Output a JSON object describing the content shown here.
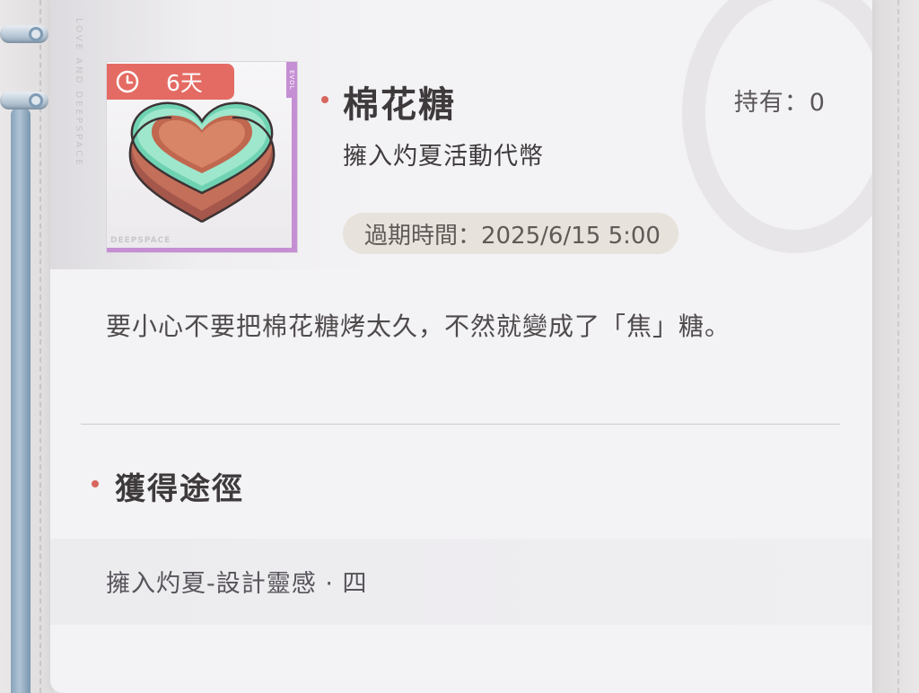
{
  "item": {
    "name": "棉花糖",
    "type": "擁入灼夏活動代幣",
    "owned": "持有：0",
    "expire": "過期時間：2025/6/15 5:00",
    "duration_badge": "6天",
    "description": "要小心不要把棉花糖烤太久，不然就變成了「焦」糖。",
    "frame_tag": "EVOL",
    "brand_tag": "DEEPSPACE"
  },
  "side_text": "LOVE AND DEEPSPACE",
  "acquire": {
    "title": "獲得途徑",
    "routes": [
      "擁入灼夏-設計靈感 · 四"
    ]
  },
  "colors": {
    "accent": "#e46b63",
    "bullet": "#d7675e",
    "frame_purple": "#c58fd4",
    "pill_bg": "#e8e2dc"
  },
  "icons": [
    "clock-icon",
    "marshmallow-heart-icon",
    "bullet-dot-icon"
  ]
}
